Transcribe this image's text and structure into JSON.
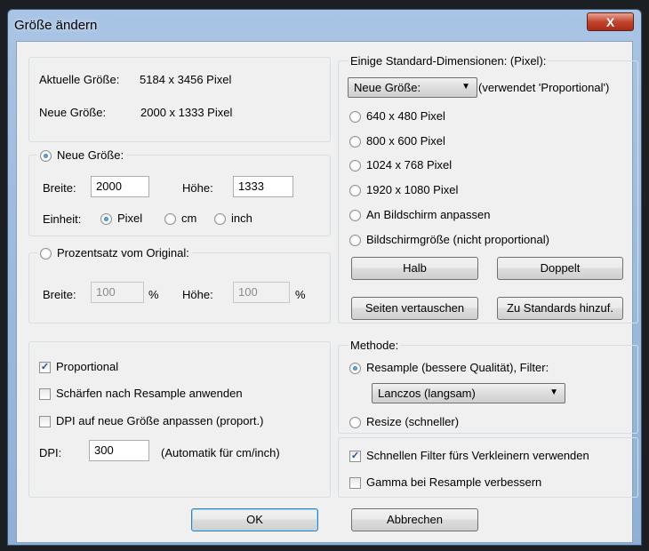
{
  "window": {
    "title": "Größe ändern",
    "close_symbol": "X"
  },
  "size_info": {
    "current_label": "Aktuelle Größe:",
    "current_value": "5184  x  3456  Pixel",
    "new_label": "Neue Größe:",
    "new_value": "2000  x  1333  Pixel"
  },
  "new_size": {
    "legend": "Neue Größe:",
    "width_label": "Breite:",
    "width_value": "2000",
    "height_label": "Höhe:",
    "height_value": "1333",
    "unit_label": "Einheit:",
    "units": [
      "Pixel",
      "cm",
      "inch"
    ],
    "selected_unit": "Pixel"
  },
  "percent": {
    "legend": "Prozentsatz vom Original:",
    "width_label": "Breite:",
    "width_value": "100",
    "width_unit": "%",
    "height_label": "Höhe:",
    "height_value": "100",
    "height_unit": "%"
  },
  "options": {
    "proportional": "Proportional",
    "sharpen": "Schärfen nach Resample anwenden",
    "dpi_adjust": "DPI auf neue Größe anpassen (proport.)",
    "dpi_label": "DPI:",
    "dpi_value": "300",
    "dpi_note": "(Automatik für cm/inch)"
  },
  "standard": {
    "legend": "Einige Standard-Dimensionen: (Pixel):",
    "dropdown_value": "Neue Größe:",
    "dropdown_note": "(verwendet 'Proportional')",
    "presets": [
      "640 x 480 Pixel",
      "800 x 600 Pixel",
      "1024 x 768 Pixel",
      "1920 x 1080 Pixel",
      "An Bildschirm anpassen",
      "Bildschirmgröße (nicht proportional)"
    ],
    "half_button": "Halb",
    "double_button": "Doppelt",
    "swap_button": "Seiten vertauschen",
    "add_button": "Zu Standards hinzuf."
  },
  "method": {
    "legend": "Methode:",
    "resample": "Resample (bessere Qualität), Filter:",
    "filter_value": "Lanczos (langsam)",
    "resize": "Resize (schneller)",
    "fast_filter": "Schnellen Filter fürs Verkleinern verwenden",
    "gamma": "Gamma bei Resample verbessern"
  },
  "footer": {
    "ok": "OK",
    "cancel": "Abbrechen"
  }
}
